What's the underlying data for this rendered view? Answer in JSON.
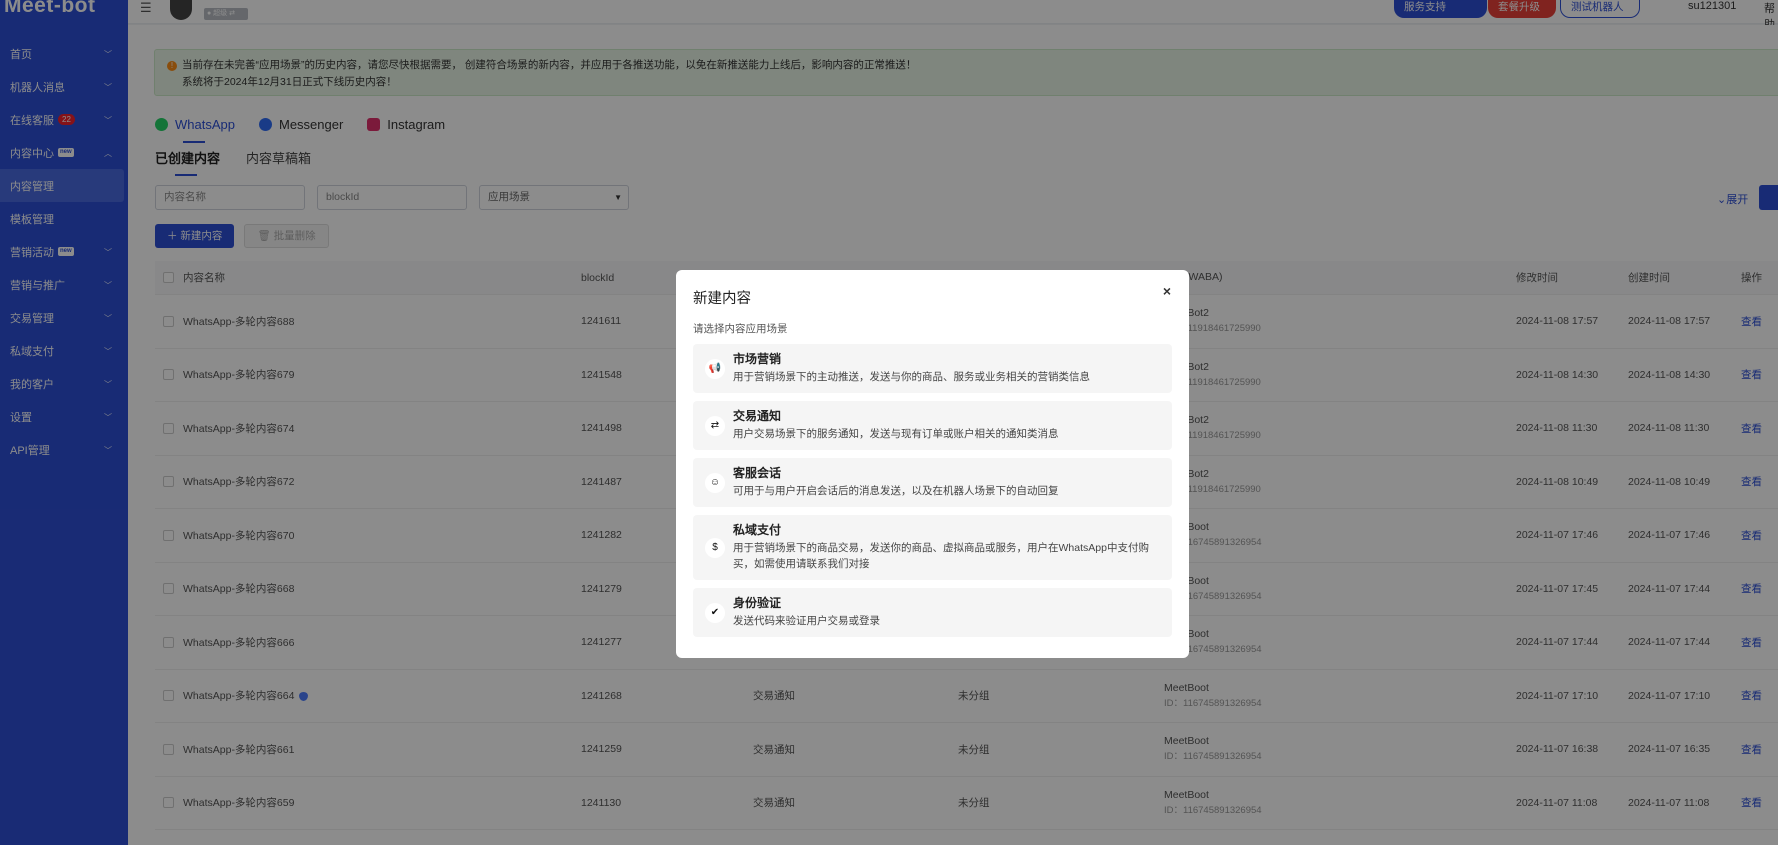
{
  "app": {
    "logo": "Meet-bot"
  },
  "sidebar": {
    "items": [
      {
        "label": "首页"
      },
      {
        "label": "机器人消息"
      },
      {
        "label": "在线客服",
        "badge": "22"
      },
      {
        "label": "内容中心",
        "tag": "new"
      },
      {
        "label": "内容管理"
      },
      {
        "label": "模板管理"
      },
      {
        "label": "营销活动",
        "tag": "new"
      },
      {
        "label": "营销与推广"
      },
      {
        "label": "交易管理"
      },
      {
        "label": "私域支付"
      },
      {
        "label": "我的客户"
      },
      {
        "label": "设置"
      },
      {
        "label": "API管理"
      }
    ]
  },
  "header": {
    "menu_icon": "☰",
    "role": "● 超级 ⇄",
    "support": "服务支持",
    "upgrade": "套餐升级",
    "test_bot": "测试机器人",
    "username": "su121301",
    "help": "帮助"
  },
  "notice": {
    "line1": "当前存在未完善“应用场景”的历史内容，请您尽快根据需要， 创建符合场景的新内容，并应用于各推送功能，以免在新推送能力上线后，影响内容的正常推送！",
    "line2": "系统将于2024年12月31日正式下线历史内容！"
  },
  "channels": [
    {
      "label": "WhatsApp",
      "icon": "whatsapp-icon"
    },
    {
      "label": "Messenger",
      "icon": "messenger-icon"
    },
    {
      "label": "Instagram",
      "icon": "instagram-icon"
    }
  ],
  "subtabs": [
    {
      "label": "已创建内容"
    },
    {
      "label": "内容草稿箱"
    }
  ],
  "filters": {
    "name_placeholder": "内容名称",
    "block_placeholder": "blockId",
    "scene_placeholder": "应用场景",
    "expand": "展开"
  },
  "actions": {
    "create": "新建内容",
    "batch_delete": "批量删除"
  },
  "table": {
    "headers": {
      "name": "内容名称",
      "blockid": "blockId",
      "waba": "账号(WABA)",
      "modified": "修改时间",
      "created": "创建时间",
      "op": "操作"
    },
    "rows": [
      {
        "name": "WhatsApp-多轮内容688",
        "blockid": "1241611",
        "scene": "",
        "group": "",
        "acct": "MeetBot2",
        "acct_id": "ID：111918461725990",
        "modified": "2024-11-08 17:57",
        "created": "2024-11-08 17:57",
        "op": "查看"
      },
      {
        "name": "WhatsApp-多轮内容679",
        "blockid": "1241548",
        "scene": "",
        "group": "",
        "acct": "MeetBot2",
        "acct_id": "ID：111918461725990",
        "modified": "2024-11-08 14:30",
        "created": "2024-11-08 14:30",
        "op": "查看"
      },
      {
        "name": "WhatsApp-多轮内容674",
        "blockid": "1241498",
        "scene": "",
        "group": "",
        "acct": "MeetBot2",
        "acct_id": "ID：111918461725990",
        "modified": "2024-11-08 11:30",
        "created": "2024-11-08 11:30",
        "op": "查看"
      },
      {
        "name": "WhatsApp-多轮内容672",
        "blockid": "1241487",
        "scene": "",
        "group": "",
        "acct": "MeetBot2",
        "acct_id": "ID：111918461725990",
        "modified": "2024-11-08 10:49",
        "created": "2024-11-08 10:49",
        "op": "查看"
      },
      {
        "name": "WhatsApp-多轮内容670",
        "blockid": "1241282",
        "scene": "",
        "group": "",
        "acct": "MeetBoot",
        "acct_id": "ID：116745891326954",
        "modified": "2024-11-07 17:46",
        "created": "2024-11-07 17:46",
        "op": "查看"
      },
      {
        "name": "WhatsApp-多轮内容668",
        "blockid": "1241279",
        "scene": "",
        "group": "",
        "acct": "MeetBoot",
        "acct_id": "ID：116745891326954",
        "modified": "2024-11-07 17:45",
        "created": "2024-11-07 17:44",
        "op": "查看"
      },
      {
        "name": "WhatsApp-多轮内容666",
        "blockid": "1241277",
        "scene": "",
        "group": "",
        "acct": "MeetBoot",
        "acct_id": "ID：116745891326954",
        "modified": "2024-11-07 17:44",
        "created": "2024-11-07 17:44",
        "op": "查看"
      },
      {
        "name": "WhatsApp-多轮内容664",
        "blockid": "1241268",
        "scene": "交易通知",
        "group": "未分组",
        "acct": "MeetBoot",
        "acct_id": "ID：116745891326954",
        "modified": "2024-11-07 17:10",
        "created": "2024-11-07 17:10",
        "op": "查看",
        "shield": true
      },
      {
        "name": "WhatsApp-多轮内容661",
        "blockid": "1241259",
        "scene": "交易通知",
        "group": "未分组",
        "acct": "MeetBoot",
        "acct_id": "ID：116745891326954",
        "modified": "2024-11-07 16:38",
        "created": "2024-11-07 16:35",
        "op": "查看"
      },
      {
        "name": "WhatsApp-多轮内容659",
        "blockid": "1241130",
        "scene": "交易通知",
        "group": "未分组",
        "acct": "MeetBoot",
        "acct_id": "ID：116745891326954",
        "modified": "2024-11-07 11:08",
        "created": "2024-11-07 11:08",
        "op": "查看"
      }
    ]
  },
  "modal": {
    "title": "新建内容",
    "close": "×",
    "subtitle": "请选择内容应用场景",
    "options": [
      {
        "title": "市场营销",
        "desc": "用于营销场景下的主动推送，发送与你的商品、服务或业务相关的营销类信息",
        "icon": "megaphone-icon"
      },
      {
        "title": "交易通知",
        "desc": "用户交易场景下的服务通知，发送与现有订单或账户相关的通知类消息",
        "icon": "transaction-icon"
      },
      {
        "title": "客服会话",
        "desc": "可用于与用户开启会话后的消息发送，以及在机器人场景下的自动回复",
        "icon": "agent-icon"
      },
      {
        "title": "私域支付",
        "desc": "用于营销场景下的商品交易，发送你的商品、虚拟商品或服务，用户在WhatsApp中支付购买，如需使用请联系我们对接",
        "icon": "money-bag-icon"
      },
      {
        "title": "身份验证",
        "desc": "发送代码来验证用户交易或登录",
        "icon": "shield-check-icon"
      }
    ]
  },
  "colors": {
    "primary": "#2d4fd6",
    "danger": "#e9413a",
    "notice_bg": "#e7f5e5"
  }
}
